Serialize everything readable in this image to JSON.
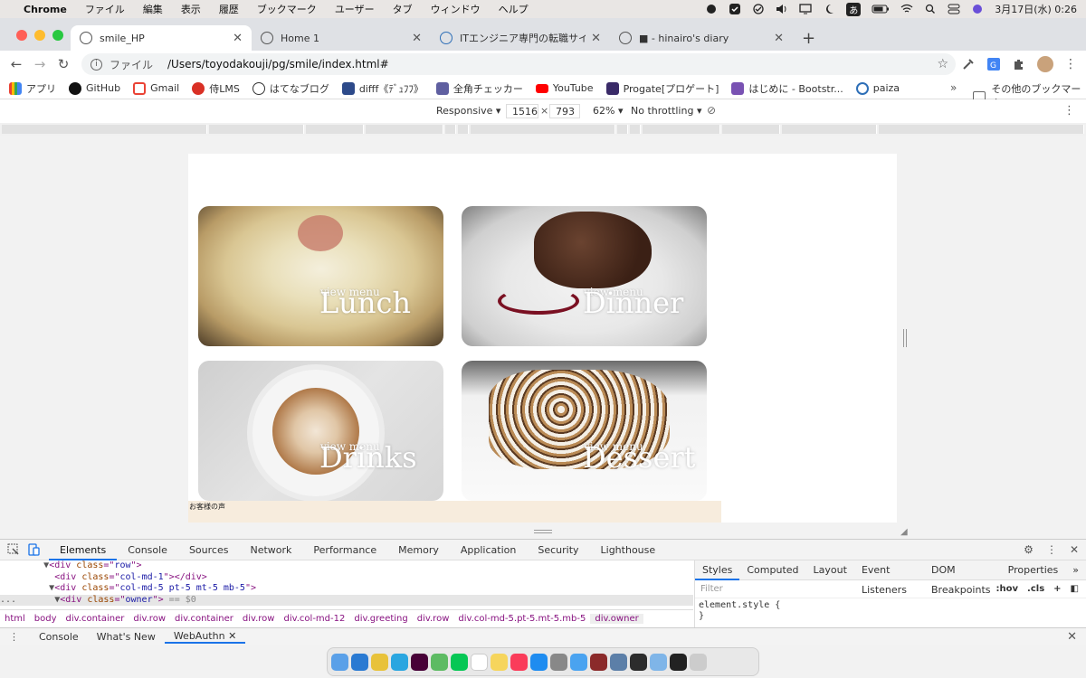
{
  "menubar": {
    "app_name": "Chrome",
    "items": [
      "ファイル",
      "編集",
      "表示",
      "履歴",
      "ブックマーク",
      "ユーザー",
      "タブ",
      "ウィンドウ",
      "ヘルプ"
    ],
    "ime": "あ",
    "clock": "3月17日(水)  0:26"
  },
  "tabs": [
    {
      "title": "smile_HP",
      "active": true
    },
    {
      "title": "Home 1",
      "active": false
    },
    {
      "title": "ITエンジニア専門の転職サイト【p",
      "active": false
    },
    {
      "title": "■ - hinairo's diary",
      "active": false
    }
  ],
  "address": {
    "scheme": "ファイル",
    "url": "/Users/toyodakouji/pg/smile/index.html#"
  },
  "bookmarks": [
    {
      "label": "アプリ",
      "color": "#e94235"
    },
    {
      "label": "GitHub",
      "color": "#111111"
    },
    {
      "label": "Gmail",
      "color": "#ea4335"
    },
    {
      "label": "侍LMS",
      "color": "#d93025"
    },
    {
      "label": "はてなブログ",
      "color": "#333333"
    },
    {
      "label": "difff《ﾃﾞｭﾌﾌ》",
      "color": "#2d4a8a"
    },
    {
      "label": "全角チェッカー",
      "color": "#5f5fa0"
    },
    {
      "label": "YouTube",
      "color": "#ff0000"
    },
    {
      "label": "Progate[プロゲート]",
      "color": "#3a2b68"
    },
    {
      "label": "はじめに - Bootstr...",
      "color": "#7952b3"
    },
    {
      "label": "paiza",
      "color": "#2e6fb7"
    }
  ],
  "bookmarks_more": "»",
  "bookmarks_other": "その他のブックマーク",
  "device_toolbar": {
    "mode": "Responsive ▾",
    "width": "1516",
    "height": "793",
    "times": "×",
    "zoom": "62% ▾",
    "throttling": "No throttling ▾"
  },
  "page": {
    "cards": [
      {
        "key": "lunch",
        "view": "view menu",
        "title": "Lunch"
      },
      {
        "key": "dinner",
        "view": "view menu",
        "title": "Dinner"
      },
      {
        "key": "drinks",
        "view": "view menu",
        "title": "Drinks"
      },
      {
        "key": "dessert",
        "view": "view menu",
        "title": "Dessert"
      }
    ],
    "voice_label": "お客様の声"
  },
  "devtools": {
    "tabs": [
      "Elements",
      "Console",
      "Sources",
      "Network",
      "Performance",
      "Memory",
      "Application",
      "Security",
      "Lighthouse"
    ],
    "active_tab": "Elements",
    "dom_lines": [
      {
        "indent": "        ▼",
        "tag": "div",
        "attr": "class",
        "val": "row",
        "close": ">",
        "suffix": ""
      },
      {
        "indent": "          ",
        "tag": "div",
        "attr": "class",
        "val": "col-md-1",
        "close": "></div>",
        "suffix": ""
      },
      {
        "indent": "         ▼",
        "tag": "div",
        "attr": "class",
        "val": "col-md-5 pt-5 mt-5 mb-5",
        "close": ">",
        "suffix": ""
      },
      {
        "indent": "...       ▼",
        "tag": "div",
        "attr": "class",
        "val": "owner",
        "close": ">",
        "suffix": " == $0"
      }
    ],
    "styles_tabs": [
      "Styles",
      "Computed",
      "Layout",
      "Event Listeners",
      "DOM Breakpoints",
      "Properties",
      "»"
    ],
    "filter_placeholder": "Filter",
    "filter_hov": ":hov",
    "filter_cls": ".cls",
    "style_rule_open": "element.style {",
    "style_rule_close": "}",
    "breadcrumbs": [
      "html",
      "body",
      "div.container",
      "div.row",
      "div.container",
      "div.row",
      "div.col-md-12",
      "div.greeting",
      "div.row",
      "div.col-md-5.pt-5.mt-5.mb-5",
      "div.owner"
    ]
  },
  "drawer": {
    "tabs": [
      "Console",
      "What's New",
      "WebAuthn"
    ],
    "active": "WebAuthn"
  },
  "dock_apps": [
    "finder",
    "vscode",
    "chrome",
    "skype",
    "xd",
    "atom",
    "line",
    "calendar",
    "notes",
    "music",
    "appstore",
    "settings",
    "mail",
    "dictionary",
    "preview",
    "quicktime",
    "folder",
    "terminal",
    "trash"
  ]
}
